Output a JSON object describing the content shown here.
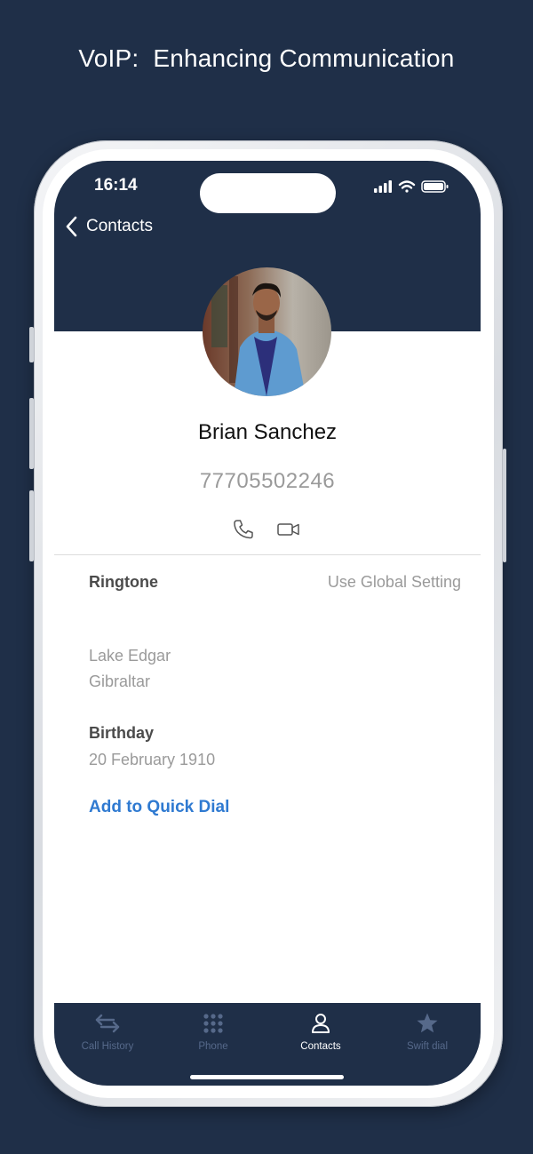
{
  "headline": "VoIP:  Enhancing Communication",
  "status_bar": {
    "time": "16:14"
  },
  "nav": {
    "back_label": "Contacts"
  },
  "contact": {
    "name": "Brian Sanchez",
    "phone": "77705502246",
    "ringtone_label": "Ringtone",
    "ringtone_value": "Use Global Setting",
    "address_line1": "Lake Edgar",
    "address_line2": "Gibraltar",
    "birthday_label": "Birthday",
    "birthday_value": "20 February 1910",
    "quick_dial_label": "Add to Quick Dial"
  },
  "tabs": [
    {
      "label": "Call History",
      "icon": "call-history-arrows-icon",
      "active": false
    },
    {
      "label": "Phone",
      "icon": "keypad-icon",
      "active": false
    },
    {
      "label": "Contacts",
      "icon": "person-icon",
      "active": true
    },
    {
      "label": "Swift dial",
      "icon": "star-icon",
      "active": false
    }
  ],
  "colors": {
    "background": "#1f2f48",
    "link": "#2f7ad1",
    "tab_inactive": "#56698a",
    "tab_active": "#ffffff"
  }
}
